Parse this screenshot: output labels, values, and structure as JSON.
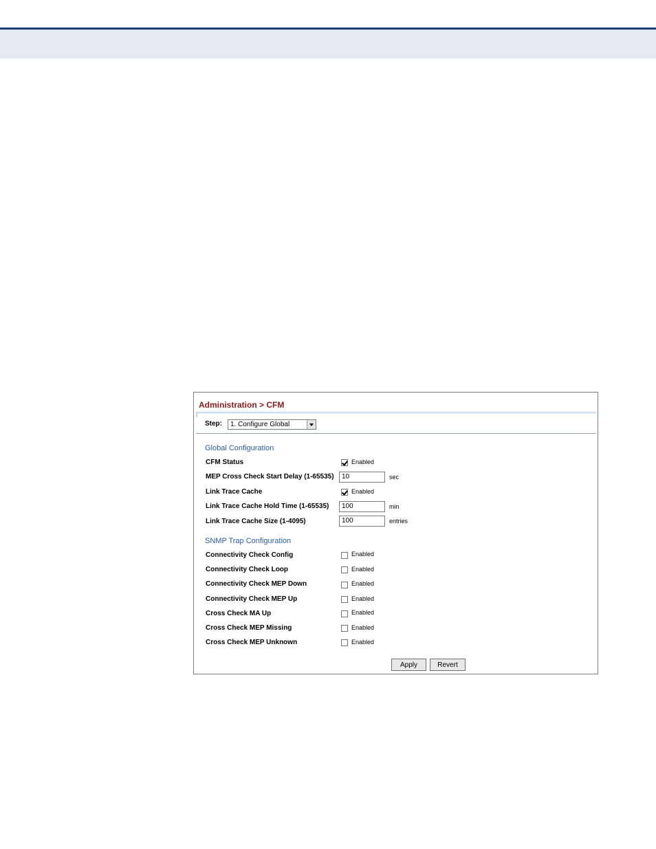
{
  "breadcrumb": "Administration > CFM",
  "step": {
    "label": "Step:",
    "selected": "1. Configure Global"
  },
  "global": {
    "title": "Global Configuration",
    "rows": [
      {
        "label": "CFM Status",
        "checkbox": "Enabled",
        "checked": true
      },
      {
        "label": "MEP Cross Check Start Delay (1-65535)",
        "value": "10",
        "unit": "sec"
      },
      {
        "label": "Link Trace Cache",
        "checkbox": "Enabled",
        "checked": true
      },
      {
        "label": "Link Trace Cache Hold Time (1-65535)",
        "value": "100",
        "unit": "min"
      },
      {
        "label": "Link Trace Cache Size (1-4095)",
        "value": "100",
        "unit": "entries"
      }
    ]
  },
  "snmp": {
    "title": "SNMP Trap Configuration",
    "rows": [
      {
        "label": "Connectivity Check Config",
        "checkbox": "Enabled",
        "checked": false
      },
      {
        "label": "Connectivity Check Loop",
        "checkbox": "Enabled",
        "checked": false
      },
      {
        "label": "Connectivity Check MEP Down",
        "checkbox": "Enabled",
        "checked": false
      },
      {
        "label": "Connectivity Check MEP Up",
        "checkbox": "Enabled",
        "checked": false
      },
      {
        "label": "Cross Check MA Up",
        "checkbox": "Enabled",
        "checked": false
      },
      {
        "label": "Cross Check MEP Missing",
        "checkbox": "Enabled",
        "checked": false
      },
      {
        "label": "Cross Check MEP Unknown",
        "checkbox": "Enabled",
        "checked": false
      }
    ]
  },
  "buttons": {
    "apply": "Apply",
    "revert": "Revert"
  }
}
